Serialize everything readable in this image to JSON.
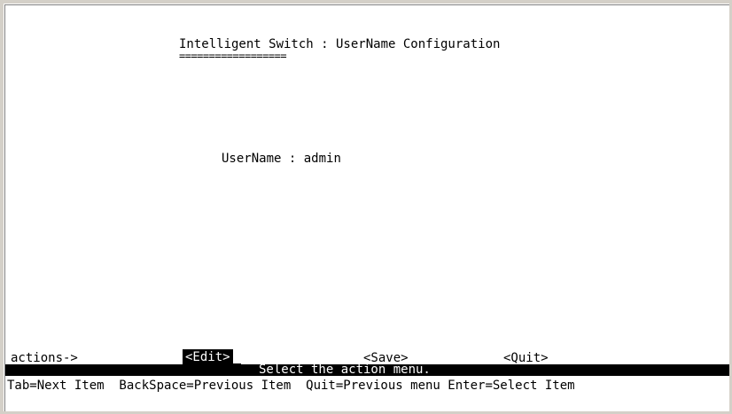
{
  "screen": {
    "title": "Intelligent Switch : UserName Configuration",
    "title_underline": "=================="
  },
  "form": {
    "username_label": "UserName",
    "separator": ":",
    "username_value": "admin"
  },
  "actions": {
    "label": "actions->",
    "edit": "<Edit>",
    "save": "<Save>",
    "quit": "<Quit>"
  },
  "status": {
    "message": "Select the action menu."
  },
  "help": {
    "text": "Tab=Next Item  BackSpace=Previous Item  Quit=Previous menu Enter=Select Item"
  },
  "colors": {
    "terminal_bg": "#ffffff",
    "terminal_fg": "#000000",
    "highlight_bg": "#000000",
    "highlight_fg": "#ffffff",
    "window_border": "#d4d0c8"
  }
}
